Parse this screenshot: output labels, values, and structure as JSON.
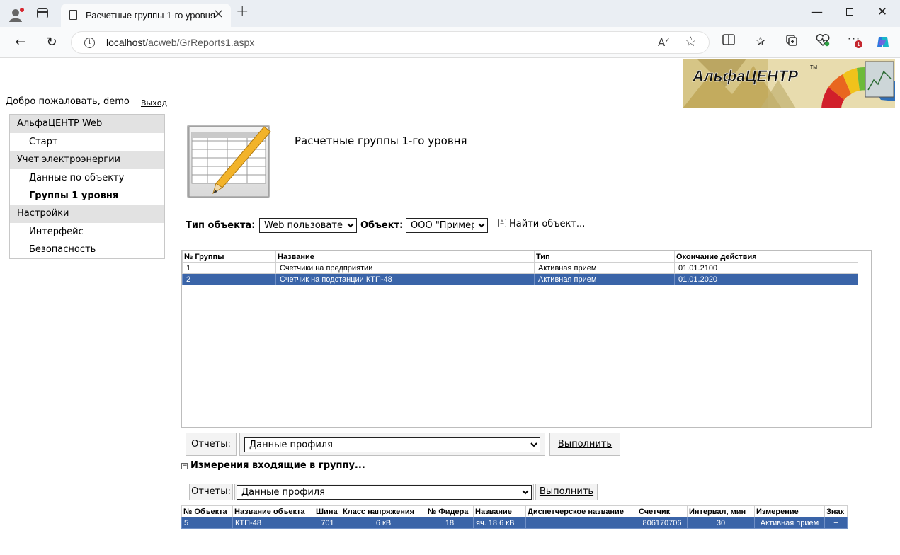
{
  "browser": {
    "tab_title": "Расчетные группы 1-го уровня",
    "url_host": "localhost",
    "url_path": "/acweb/GrReports1.aspx",
    "notification_badge": "1"
  },
  "header": {
    "logo_text": "АльфаЦЕНТР",
    "logo_tm": "TM",
    "welcome": "Добро пожаловать, demo",
    "logout": "Выход"
  },
  "menu": [
    {
      "type": "head",
      "label": "АльфаЦЕНТР Web"
    },
    {
      "type": "item",
      "label": "Старт"
    },
    {
      "type": "head",
      "label": "Учет электроэнергии"
    },
    {
      "type": "item",
      "label": "Данные по объекту"
    },
    {
      "type": "item",
      "label": "Группы 1 уровня",
      "active": true
    },
    {
      "type": "head",
      "label": "Настройки"
    },
    {
      "type": "item",
      "label": "Интерфейс"
    },
    {
      "type": "item",
      "label": "Безопасность"
    }
  ],
  "page_title": "Расчетные группы 1-го уровня",
  "filter": {
    "type_label": "Тип объекта:",
    "type_value": "Web пользователи",
    "object_label": "Объект:",
    "object_value": "ООО \"Пример\"",
    "find_label": "Найти объект..."
  },
  "groups": {
    "columns": [
      "№ Группы",
      "Название",
      "Тип",
      "Окончание действия"
    ],
    "rows": [
      {
        "no": "1",
        "name": "Счетчики на предприятии",
        "type": "Активная прием",
        "end": "01.01.2100",
        "selected": false
      },
      {
        "no": "2",
        "name": "Счетчик на подстанции КТП-48",
        "type": "Активная прием",
        "end": "01.01.2020",
        "selected": true
      }
    ]
  },
  "reports": {
    "label": "Отчеты:",
    "value": "Данные профиля",
    "run": "Выполнить"
  },
  "measurements": {
    "header": "Измерения входящие в группу...",
    "collapse_glyph": "−",
    "reports_label": "Отчеты:",
    "reports_value": "Данные профиля",
    "run": "Выполнить",
    "columns": [
      "№ Объекта",
      "Название объекта",
      "Шина",
      "Класс напряжения",
      "№ Фидера",
      "Название",
      "Диспетчерское название",
      "Счетчик",
      "Интервал, мин",
      "Измерение",
      "Знак"
    ],
    "rows": [
      {
        "obj_no": "5",
        "obj_name": "КТП-48",
        "bus": "701",
        "voltage": "6 кВ",
        "feeder": "18",
        "name": "яч. 18 6 кВ",
        "dispatch": "",
        "meter": "806170706",
        "interval": "30",
        "measure": "Активная прием",
        "sign": "+"
      }
    ]
  }
}
